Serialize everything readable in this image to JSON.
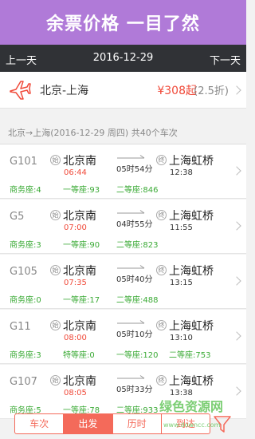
{
  "banner": {
    "title": "余票价格  一目了然"
  },
  "datebar": {
    "prev": "上一天",
    "date": "2016-12-29",
    "next": "下一天"
  },
  "route": {
    "name": "北京-上海",
    "price": "¥308起",
    "discount": "(2.5折)"
  },
  "summary": "北京→上海(2016-12-29 周四) 共40个车次",
  "depart_badge": "始",
  "arrive_badge": "终",
  "trains": [
    {
      "code": "G101",
      "from": "北京南",
      "dep": "06:44",
      "duration": "05时54分",
      "to": "上海虹桥",
      "arr": "12:38",
      "seats": [
        "商务座:4",
        "一等座:93",
        "二等座:846",
        ""
      ]
    },
    {
      "code": "G5",
      "from": "北京南",
      "dep": "07:00",
      "duration": "04时55分",
      "to": "上海虹桥",
      "arr": "11:55",
      "seats": [
        "商务座:3",
        "一等座:90",
        "二等座:823",
        ""
      ]
    },
    {
      "code": "G105",
      "from": "北京南",
      "dep": "07:35",
      "duration": "05时40分",
      "to": "上海虹桥",
      "arr": "13:15",
      "seats": [
        "商务座:0",
        "一等座:17",
        "二等座:488",
        ""
      ]
    },
    {
      "code": "G11",
      "from": "北京南",
      "dep": "08:00",
      "duration": "05时10分",
      "to": "上海虹桥",
      "arr": "13:10",
      "seats": [
        "商务座:3",
        "特等座:0",
        "一等座:120",
        "二等座:753"
      ]
    },
    {
      "code": "G107",
      "from": "北京南",
      "dep": "08:05",
      "duration": "05时33分",
      "to": "上海虹桥",
      "arr": "13:38",
      "seats": [
        "商务座:5",
        "一等座:78",
        "二等座:933",
        ""
      ]
    }
  ],
  "tabs": [
    "车次",
    "出发",
    "历时",
    "到达"
  ],
  "active_tab": 1,
  "watermark": {
    "text": "绿色资源网",
    "url": "www.downcc.com"
  },
  "colors": {
    "banner": "#b07ad8",
    "datebar": "#303236",
    "accent": "#f46a5a",
    "seat": "#3aaa35",
    "price": "#f04a3a"
  }
}
